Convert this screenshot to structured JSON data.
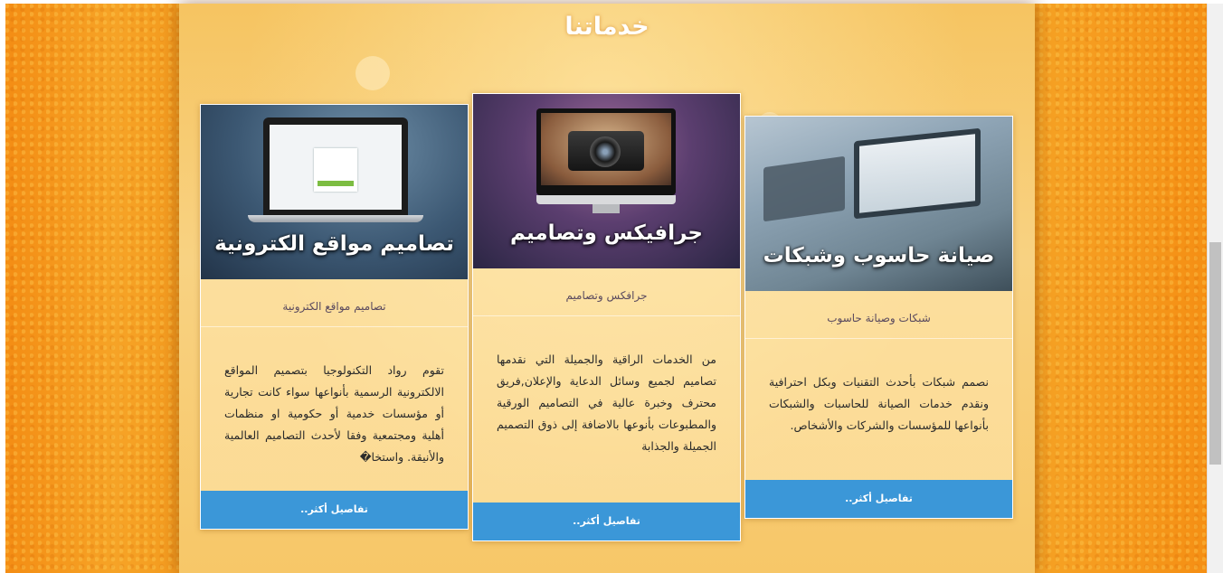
{
  "section": {
    "title": "خدماتنا"
  },
  "cards": [
    {
      "image_caption": "تصاميم مواقع الكترونية",
      "title": "تصاميم مواقع الكترونية",
      "body": "تقوم رواد التكنولوجيا بتصميم المواقع الالكترونية الرسمية بأنواعها سواء كانت تجارية أو مؤسسات خدمية أو حكومية او منظمات أهلية ومجتمعية وفقا لأحدث التصاميم العالمية والأنيقة. واستخا�",
      "button": "تفاصيل أكثر.."
    },
    {
      "image_caption": "جرافيكس وتصاميم",
      "title": "جرافكس وتصاميم",
      "body": "من الخدمات الراقية والجميلة التي نقدمها تصاميم لجميع وسائل الدعاية والإعلان,فريق محترف وخبرة عالية في التصاميم الورقية والمطبوعات بأنوعها بالاضافة إلى ذوق التصميم الجميلة والجذابة",
      "button": "تفاصيل أكثر.."
    },
    {
      "image_caption": "صيانة حاسوب وشبكات",
      "title": "شبكات وصيانة حاسوب",
      "body": "نصمم شبكات بأحدث التقنيات وبكل احترافية ونقدم خدمات الصيانة للحاسبات والشبكات بأنواعها للمؤسسات والشركات والأشخاص.",
      "button": "تفاصيل أكثر.."
    }
  ],
  "icons": {
    "laptop": "laptop-icon",
    "camera": "camera-icon",
    "network": "network-laptops-icon"
  },
  "colors": {
    "accent_button": "#3b97d8",
    "page_orange": "#f49b1f",
    "panel_light": "#f8d282"
  }
}
